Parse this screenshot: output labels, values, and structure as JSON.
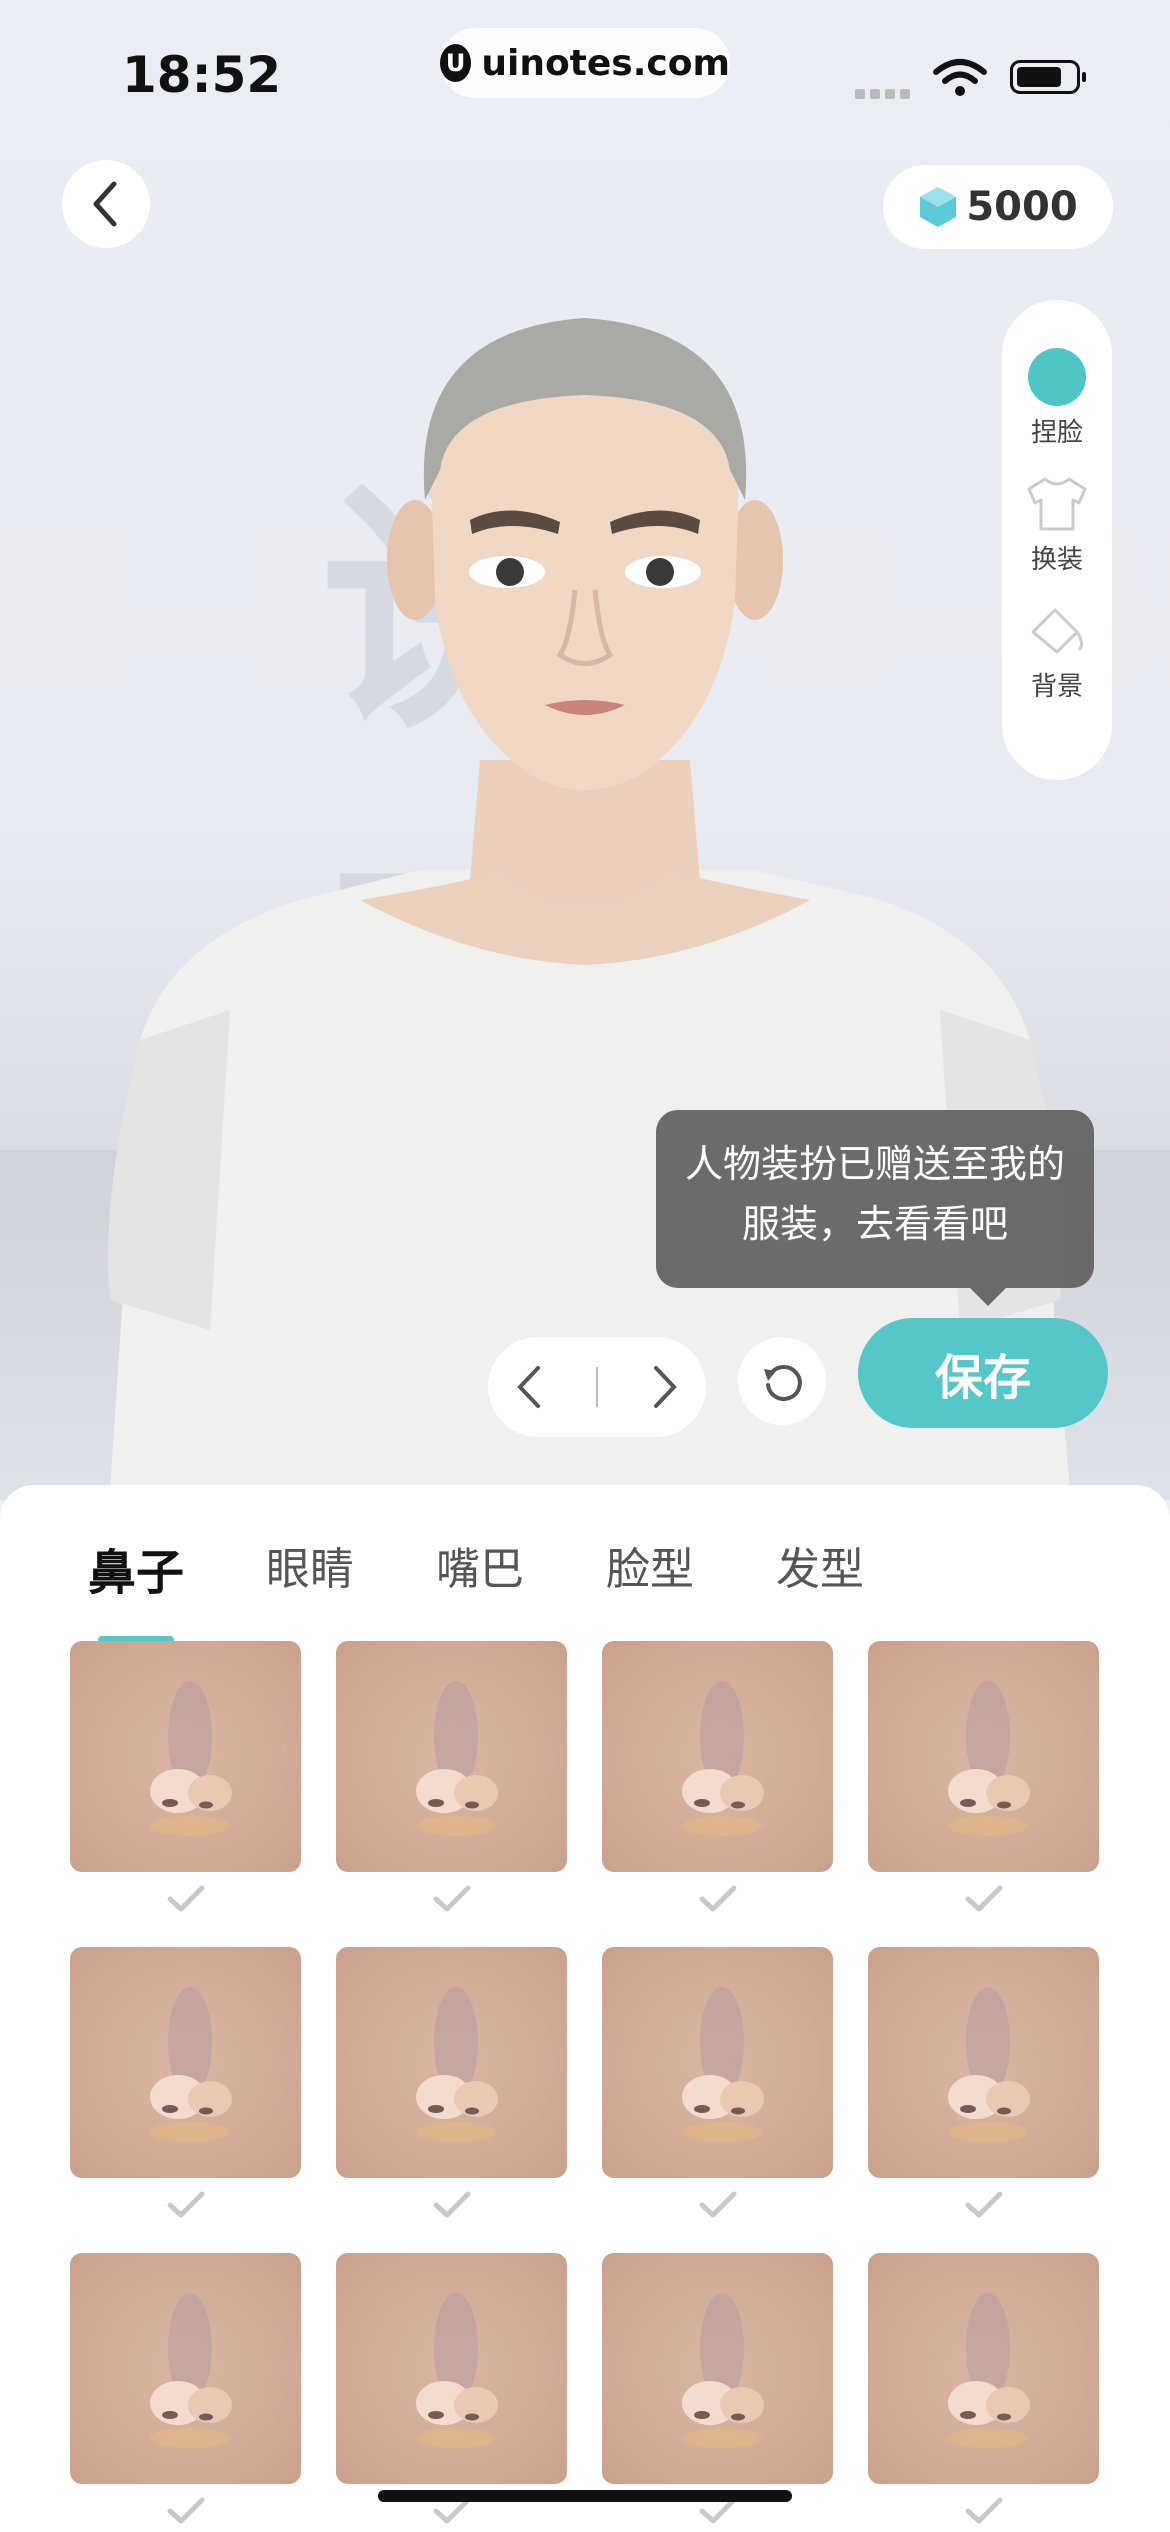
{
  "status_bar": {
    "time": "18:52",
    "url": "uinotes.com",
    "url_logo": "U"
  },
  "header": {
    "back_icon": "chevron-left-icon",
    "coins": "5000",
    "coin_icon": "gem-icon"
  },
  "side_menu": {
    "items": [
      {
        "label": "捏脸",
        "icon": "face-icon",
        "active": true
      },
      {
        "label": "换装",
        "icon": "shirt-icon",
        "active": false
      },
      {
        "label": "背景",
        "icon": "paint-bucket-icon",
        "active": false
      }
    ]
  },
  "scene": {
    "watermark": "说画"
  },
  "tooltip": {
    "line1": "人物装扮已赠送至我的",
    "line2": "服装，去看看吧"
  },
  "controls": {
    "save_label": "保存"
  },
  "tabs": [
    {
      "label": "鼻子",
      "active": true
    },
    {
      "label": "眼睛",
      "active": false
    },
    {
      "label": "嘴巴",
      "active": false
    },
    {
      "label": "脸型",
      "active": false
    },
    {
      "label": "发型",
      "active": false
    }
  ],
  "colors": {
    "accent": "#55c7c8",
    "skin": "#d2ac98"
  }
}
